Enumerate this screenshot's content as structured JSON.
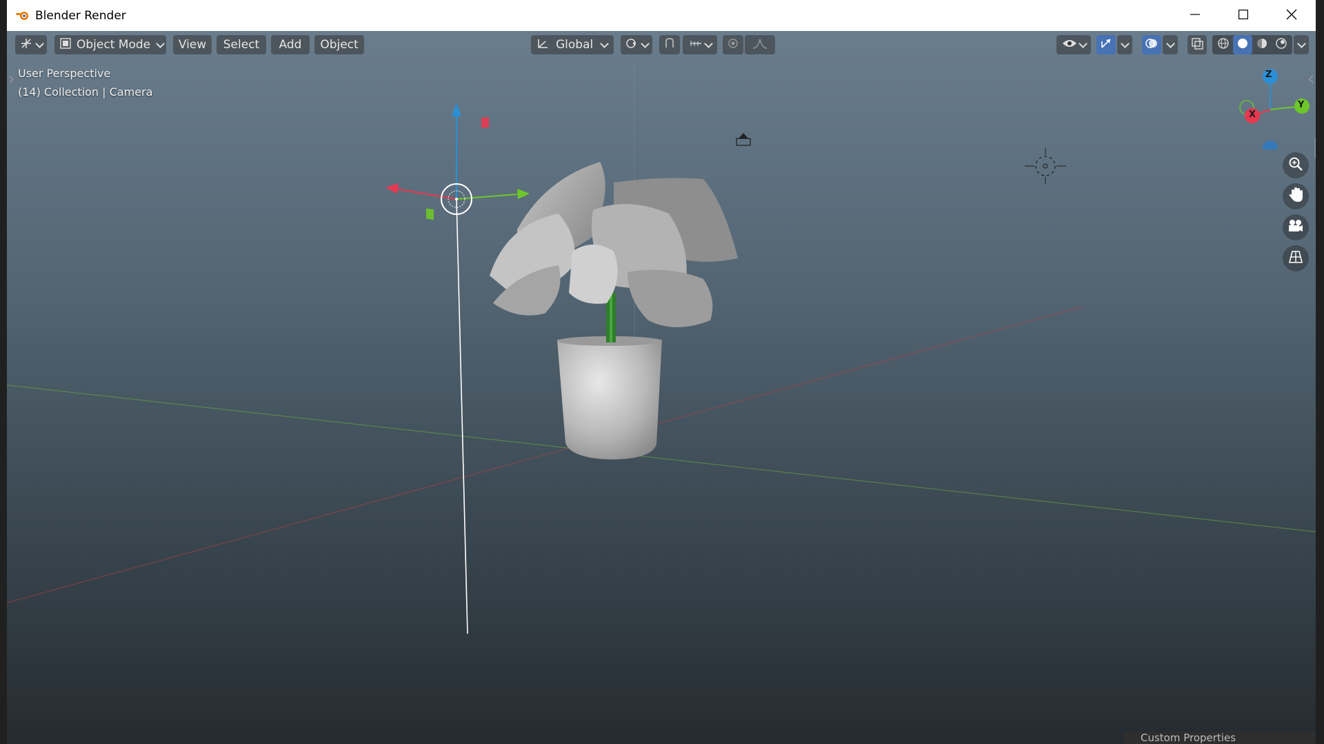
{
  "window": {
    "title": "Blender Render"
  },
  "header": {
    "mode": "Object Mode",
    "menus": [
      "View",
      "Select",
      "Add",
      "Object"
    ],
    "orientation": "Global"
  },
  "viewport": {
    "perspective": "User Perspective",
    "collection": "(14) Collection | Camera"
  },
  "gizmo": {
    "x": "X",
    "y": "Y",
    "z": "Z"
  },
  "footer": {
    "panel": "Custom Properties"
  },
  "colors": {
    "accent": "#4772b3",
    "x_axis": "#e8384f",
    "y_axis": "#6ec72a",
    "z_axis": "#2b8fd6"
  },
  "icons": [
    "blender-logo-icon",
    "minimize-icon",
    "maximize-icon",
    "close-icon",
    "editor-type-icon",
    "object-mode-icon",
    "orientation-icon",
    "pivot-icon",
    "snap-icon",
    "snap-increment-icon",
    "proportional-icon",
    "falloff-icon",
    "visibility-icon",
    "gizmo-icon",
    "overlay-icon",
    "xray-icon",
    "wireframe-shading-icon",
    "solid-shading-icon",
    "material-shading-icon",
    "rendered-shading-icon",
    "zoom-icon",
    "pan-hand-icon",
    "camera-view-icon",
    "ortho-grid-icon",
    "light-icon",
    "camera-object-icon"
  ]
}
